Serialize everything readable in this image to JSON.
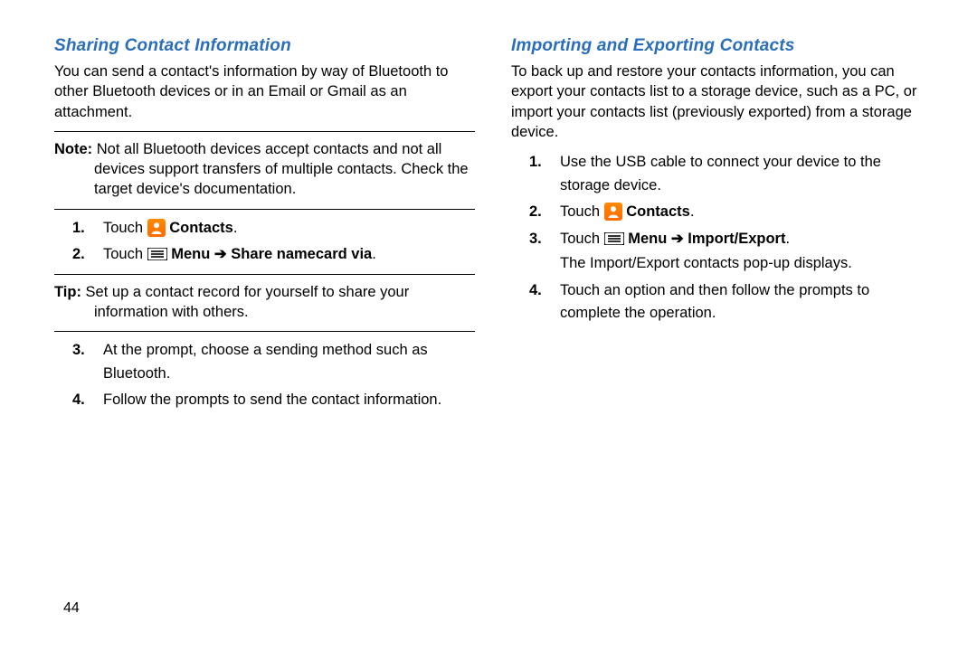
{
  "page_number": "44",
  "left": {
    "heading": "Sharing Contact Information",
    "intro": "You can send a contact's information by way of Bluetooth to other Bluetooth devices or in an Email or Gmail as an attachment.",
    "note_label": "Note:",
    "note_text": " Not all Bluetooth devices accept contacts and not all devices support transfers of multiple contacts. Check the target device's documentation.",
    "step1_touch": "Touch ",
    "step1_contacts": " Contacts",
    "step2_touch": "Touch ",
    "step2_menu": " Menu ",
    "step2_arrow": "➔",
    "step2_share": " Share namecard via",
    "tip_label": "Tip:",
    "tip_text": " Set up a contact record for yourself to share your information with others.",
    "step3": "At the prompt, choose a sending method such as Bluetooth.",
    "step4": "Follow the prompts to send the contact information."
  },
  "right": {
    "heading": "Importing and Exporting Contacts",
    "intro": "To back up and restore your contacts information, you can export your contacts list to a storage device, such as a PC, or import your contacts list (previously exported) from a storage device.",
    "step1": "Use the USB cable to connect your device to the storage device.",
    "step2_touch": "Touch ",
    "step2_contacts": " Contacts",
    "step3_touch": "Touch ",
    "step3_menu": " Menu ",
    "step3_arrow": "➔",
    "step3_impexp": " Import/Export",
    "step3_sub": "The Import/Export contacts pop-up displays.",
    "step4": "Touch an option and then follow the prompts to complete the operation."
  }
}
